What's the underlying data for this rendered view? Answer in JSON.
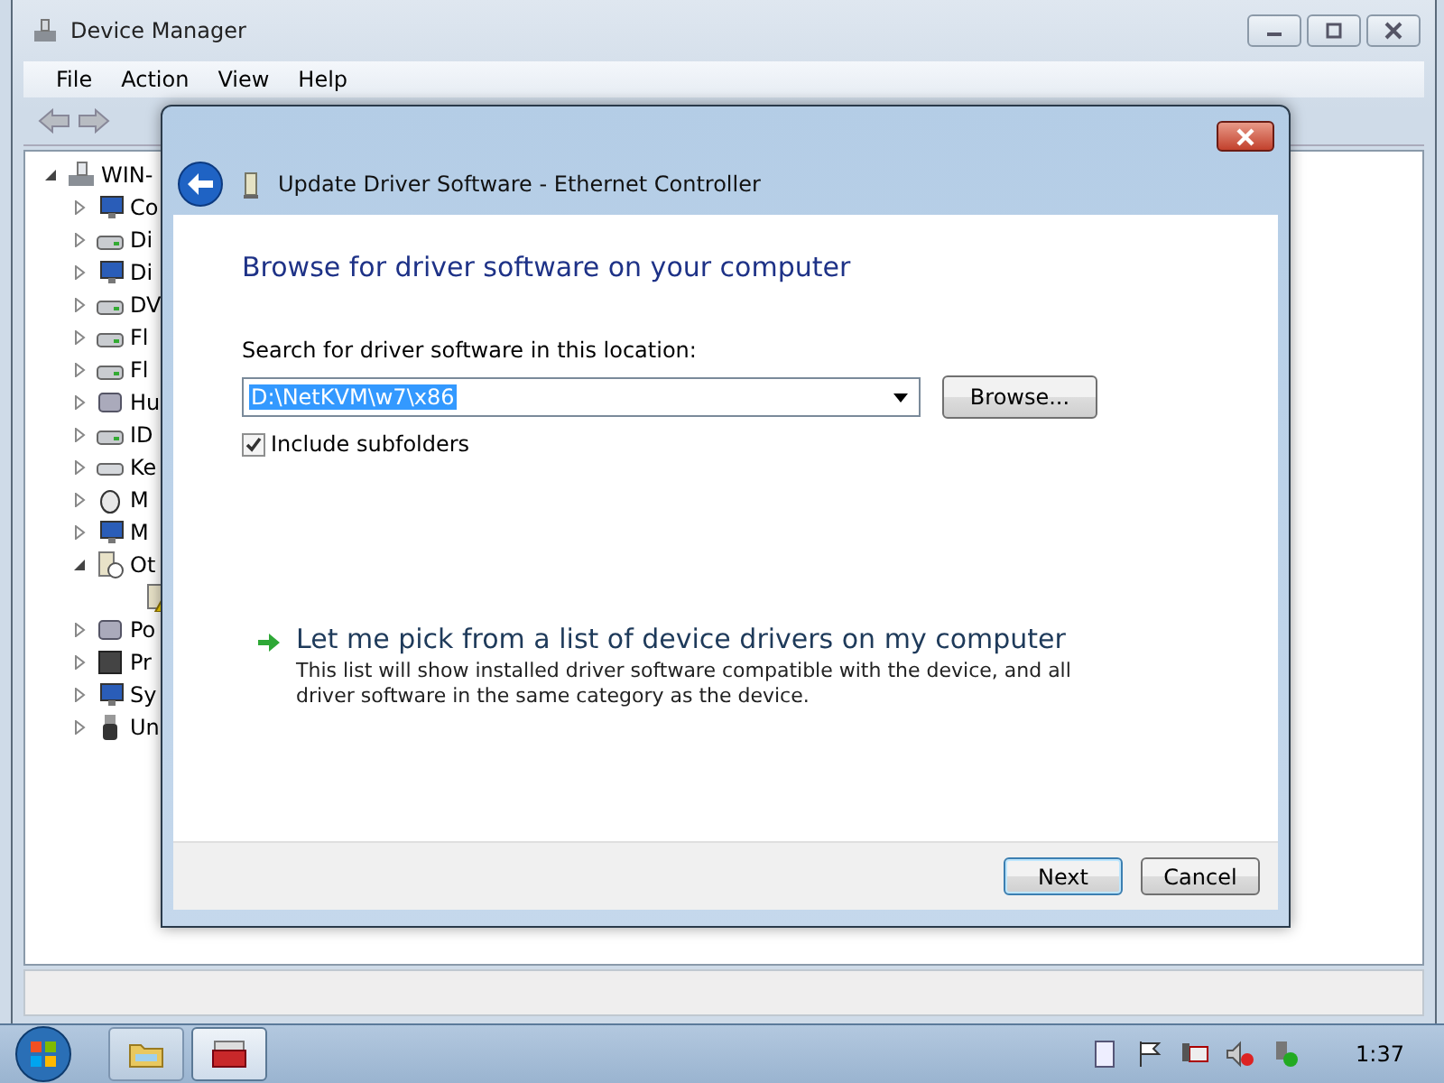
{
  "device_manager": {
    "title": "Device Manager",
    "menu": [
      {
        "label": "File"
      },
      {
        "label": "Action"
      },
      {
        "label": "View"
      },
      {
        "label": "Help"
      }
    ],
    "tree": {
      "label": "WIN-",
      "kind": "computer",
      "expanded": true,
      "children": [
        {
          "label": "Co",
          "kind": "monitor",
          "expanded": false
        },
        {
          "label": "Di",
          "kind": "drive",
          "expanded": false
        },
        {
          "label": "Di",
          "kind": "monitor",
          "expanded": false
        },
        {
          "label": "DV",
          "kind": "drive",
          "expanded": false
        },
        {
          "label": "Fl",
          "kind": "drive",
          "expanded": false
        },
        {
          "label": "Fl",
          "kind": "drive",
          "expanded": false
        },
        {
          "label": "Hu",
          "kind": "device",
          "expanded": false
        },
        {
          "label": "ID",
          "kind": "drive",
          "expanded": false
        },
        {
          "label": "Ke",
          "kind": "keyboard",
          "expanded": false
        },
        {
          "label": "M",
          "kind": "mouse",
          "expanded": false
        },
        {
          "label": "M",
          "kind": "monitor",
          "expanded": false
        },
        {
          "label": "Ot",
          "kind": "unknown",
          "expanded": true,
          "children": [
            {
              "kind": "warning"
            }
          ]
        },
        {
          "label": "Po",
          "kind": "device",
          "expanded": false
        },
        {
          "label": "Pr",
          "kind": "chip",
          "expanded": false
        },
        {
          "label": "Sy",
          "kind": "monitor",
          "expanded": false
        },
        {
          "label": "Un",
          "kind": "usb",
          "expanded": false
        }
      ]
    }
  },
  "dialog": {
    "title": "Update Driver Software - Ethernet Controller",
    "heading": "Browse for driver software on your computer",
    "location_label": "Search for driver software in this location:",
    "location_value": "D:\\NetKVM\\w7\\x86",
    "browse_button": "Browse...",
    "include_subfolders": {
      "label": "Include subfolders",
      "checked": true
    },
    "pick_option": {
      "title": "Let me pick from a list of device drivers on my computer",
      "description": "This list will show installed driver software compatible with the device, and all driver software in the same category as the device."
    },
    "buttons": [
      {
        "label": "Next",
        "default": true
      },
      {
        "label": "Cancel",
        "default": false
      }
    ]
  },
  "taskbar": {
    "tasks": [
      {
        "kind": "folder",
        "selected": false
      },
      {
        "kind": "toolbox",
        "selected": true
      }
    ],
    "tray": [
      {
        "kind": "notes"
      },
      {
        "kind": "flag"
      },
      {
        "kind": "network"
      },
      {
        "kind": "volume"
      },
      {
        "kind": "device"
      }
    ],
    "clock": "1:37"
  }
}
